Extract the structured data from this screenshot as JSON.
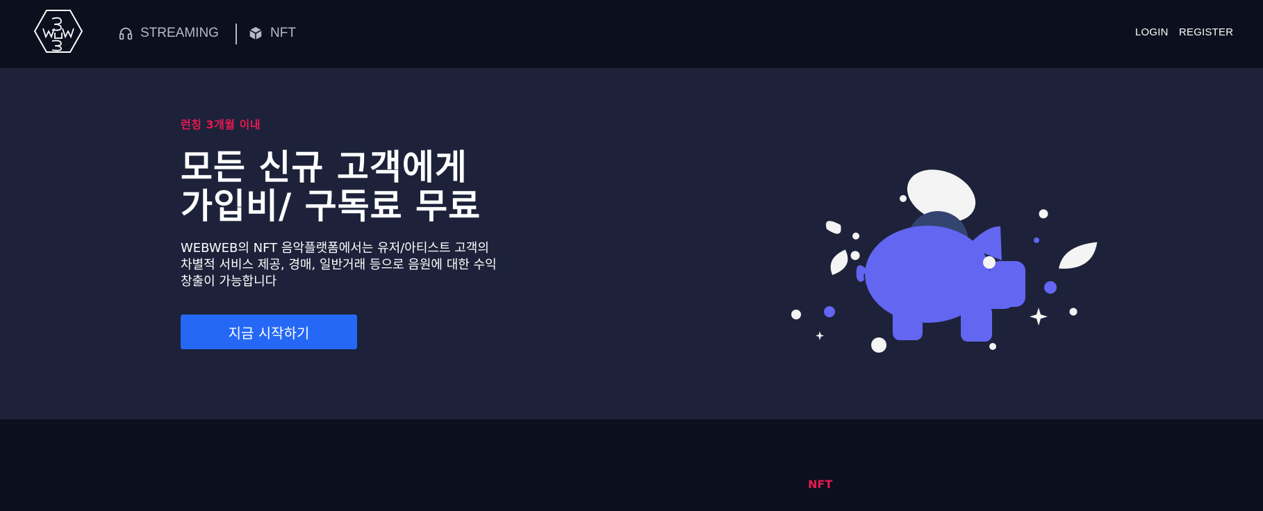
{
  "header": {
    "logo_icon": "webweb-hexagon-logo",
    "nav": [
      {
        "label": "STREAMING",
        "icon": "headphones-icon"
      },
      {
        "label": "NFT",
        "icon": "cube-icon"
      }
    ],
    "login_label": "LOGIN",
    "register_label": "REGISTER"
  },
  "hero": {
    "eyebrow": "런칭 3개월 이내",
    "headline_line1": "모든 신규 고객에게",
    "headline_line2": "가입비/ 구독료 무료",
    "description": "WEBWEB의 NFT 음악플랫폼에서는 유저/아티스트 고객의 차별적 서비스 제공, 경매, 일반거래 등으로 음원에 대한 수익 창출이 가능합니다",
    "cta_label": "지금 시작하기",
    "illustration": "piggy-bank-illustration"
  },
  "section2": {
    "eyebrow": "NFT"
  },
  "colors": {
    "background": "#0c0f1d",
    "hero_background": "#1d223a",
    "accent_red": "#e8194f",
    "cta_blue": "#2568f6",
    "piggy_purple": "#6366f1"
  }
}
